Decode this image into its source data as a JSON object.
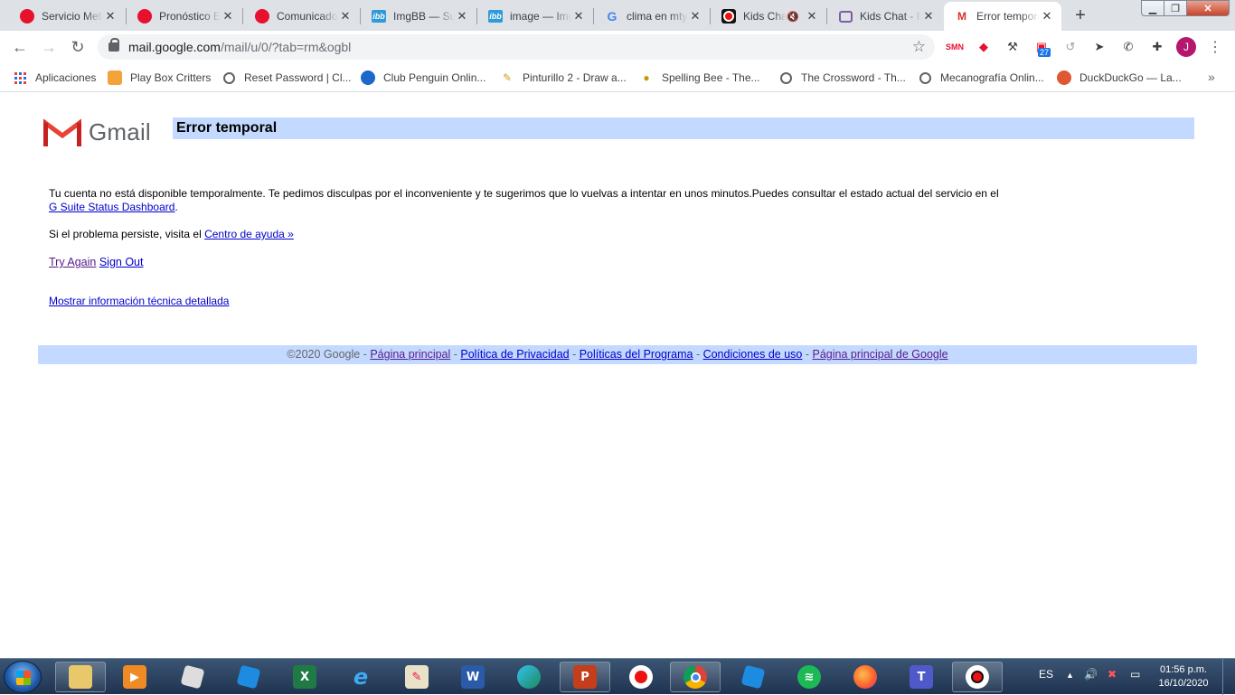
{
  "browser": {
    "tabs": [
      {
        "title": "Servicio Meteorológico",
        "favicon": "red-circle-icon"
      },
      {
        "title": "Pronóstico Extendido",
        "favicon": "red-circle-icon"
      },
      {
        "title": "Comunicados",
        "favicon": "red-circle-icon"
      },
      {
        "title": "ImgBB — Subir",
        "favicon": "imgbb-icon"
      },
      {
        "title": "image — ImgBB",
        "favicon": "imgbb-icon"
      },
      {
        "title": "clima en mty",
        "favicon": "google-g-icon"
      },
      {
        "title": "Kids Chat",
        "favicon": "kids-chat-icon",
        "muted": true
      },
      {
        "title": "Kids Chat - Free",
        "favicon": "chat-bubble-icon"
      },
      {
        "title": "Error temporal",
        "favicon": "gmail-icon",
        "active": true
      }
    ],
    "new_tab_label": "+",
    "address_bar": {
      "host": "mail.google.com",
      "path": "/mail/u/0/?tab=rm&ogbl"
    },
    "extension_badge": "27",
    "profile_initial": "J",
    "bookmarks": [
      {
        "label": "Aplicaciones",
        "icon": "apps-grid-icon"
      },
      {
        "label": "Play Box Critters",
        "icon": "box-critters-icon"
      },
      {
        "label": "Reset Password | Cl...",
        "icon": "globe-icon"
      },
      {
        "label": "Club Penguin Onlin...",
        "icon": "penguin-icon"
      },
      {
        "label": "Pinturillo 2 - Draw a...",
        "icon": "pencil-icon"
      },
      {
        "label": "Spelling Bee - The...",
        "icon": "bee-icon"
      },
      {
        "label": "The Crossword - Th...",
        "icon": "globe-icon"
      },
      {
        "label": "Mecanografía Onlin...",
        "icon": "globe-icon"
      },
      {
        "label": "DuckDuckGo — La...",
        "icon": "duckduckgo-icon"
      }
    ]
  },
  "page": {
    "logo_text": "Gmail",
    "error_title": "Error temporal",
    "message": "Tu cuenta no está disponible temporalmente. Te pedimos disculpas por el inconveniente y te sugerimos que lo vuelvas a intentar en unos minutos.Puedes consultar el estado actual del servicio en el",
    "status_link": "G Suite Status Dashboard",
    "message_end": ".",
    "persist_text": "Si el problema persiste, visita el",
    "help_link": "Centro de ayuda »",
    "try_again": "Try Again",
    "sign_out": "Sign Out",
    "tech_info": "Mostrar información técnica detallada",
    "footer": {
      "copyright": "©2020 Google",
      "sep": " - ",
      "links": [
        "Página principal",
        "Política de Privacidad",
        "Políticas del Programa",
        "Condiciones de uso",
        "Página principal de Google"
      ]
    }
  },
  "taskbar": {
    "apps": [
      "file-explorer-icon",
      "media-player-icon",
      "roblox-studio-icon",
      "roblox-icon",
      "excel-icon",
      "internet-explorer-icon",
      "paint-icon",
      "word-icon",
      "edge-icon",
      "powerpoint-icon",
      "screen-recorder-icon",
      "chrome-icon",
      "roblox-icon",
      "spotify-icon",
      "firefox-icon",
      "teams-icon",
      "webcam-icon"
    ],
    "language": "ES",
    "time": "01:56 p.m.",
    "date": "16/10/2020"
  },
  "colors": {
    "gmail_red": "#d93025",
    "error_bar": "#c3d9ff",
    "link": "#0000cc",
    "link_visited": "#551a8b"
  }
}
